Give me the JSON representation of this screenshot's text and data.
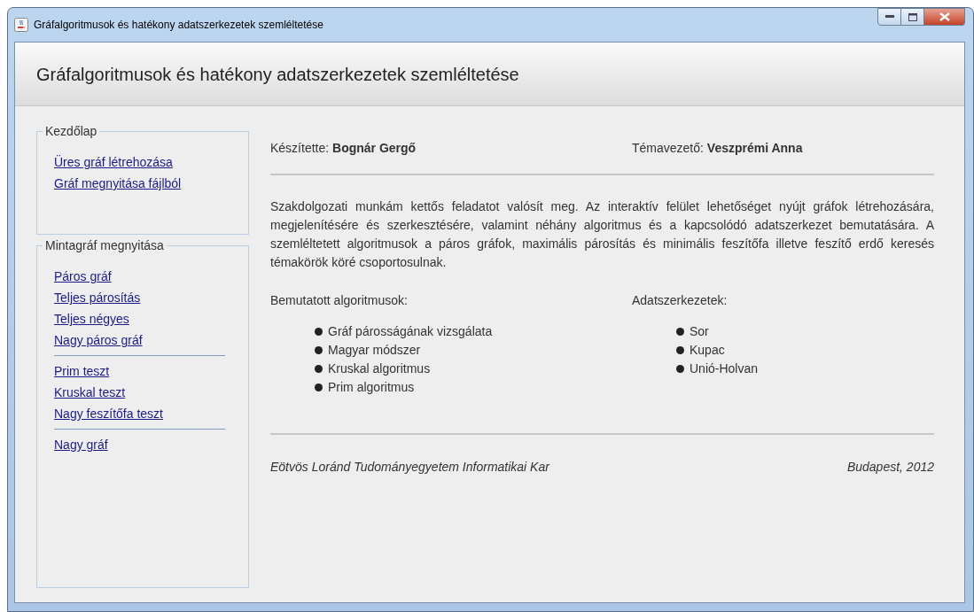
{
  "window": {
    "title": "Gráfalgoritmusok és hatékony adatszerkezetek szemléltetése"
  },
  "header": {
    "title": "Gráfalgoritmusok és hatékony adatszerkezetek szemléltetése"
  },
  "sidebar": {
    "groups": [
      {
        "title": "Kezdőlap",
        "items": [
          {
            "kind": "link",
            "label": "Üres gráf létrehozása"
          },
          {
            "kind": "link",
            "label": "Gráf megnyitása fájlból"
          }
        ]
      },
      {
        "title": "Mintagráf megnyitása",
        "items": [
          {
            "kind": "link",
            "label": "Páros gráf"
          },
          {
            "kind": "link",
            "label": "Teljes párosítás"
          },
          {
            "kind": "link",
            "label": "Teljes négyes"
          },
          {
            "kind": "link",
            "label": "Nagy páros gráf"
          },
          {
            "kind": "separator"
          },
          {
            "kind": "link",
            "label": "Prim teszt"
          },
          {
            "kind": "link",
            "label": "Kruskal teszt"
          },
          {
            "kind": "link",
            "label": "Nagy feszítőfa teszt"
          },
          {
            "kind": "separator"
          },
          {
            "kind": "link",
            "label": "Nagy gráf"
          }
        ]
      }
    ]
  },
  "content": {
    "author": "Készítette: **Bognár Gergő**",
    "supervisor": "Témavezető: **Veszprémi Anna**",
    "description": "Szakdolgozati munkám kettős feladatot valósít meg. Az interaktív felület lehetőséget nyújt gráfok létrehozására, megjelenítésére és szerkesztésére, valamint néhány algoritmus és a kapcsolódó adatszerkezet bemutatására. A szemléltetett algoritmusok a páros gráfok, maximális párosítás és minimális feszítőfa illetve feszítő erdő keresés témakörök köré csoportosulnak.",
    "lists": [
      {
        "heading": "Bemutatott algoritmusok:",
        "items": [
          "Gráf párosságának vizsgálata",
          "Magyar módszer",
          "Kruskal algoritmus",
          "Prim algoritmus"
        ]
      },
      {
        "heading": "Adatszerkezetek:",
        "items": [
          "Sor",
          "Kupac",
          "Unió-Holvan"
        ]
      }
    ],
    "footer_left": "Eötvös Loránd Tudományegyetem Informatikai Kar",
    "footer_right": "Budapest, 2012"
  }
}
